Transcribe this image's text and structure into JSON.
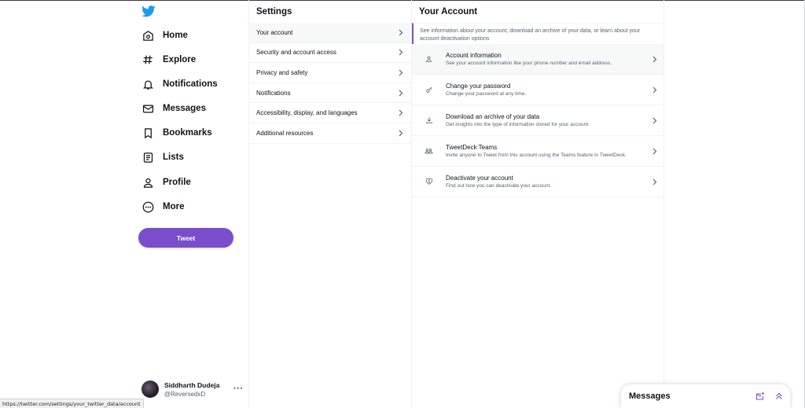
{
  "sidebar": {
    "nav": [
      {
        "label": "Home",
        "icon": "home-icon"
      },
      {
        "label": "Explore",
        "icon": "hashtag-icon"
      },
      {
        "label": "Notifications",
        "icon": "bell-icon"
      },
      {
        "label": "Messages",
        "icon": "envelope-icon"
      },
      {
        "label": "Bookmarks",
        "icon": "bookmark-icon"
      },
      {
        "label": "Lists",
        "icon": "list-icon"
      },
      {
        "label": "Profile",
        "icon": "person-icon"
      },
      {
        "label": "More",
        "icon": "more-circle-icon"
      }
    ],
    "tweet_label": "Tweet",
    "profile": {
      "name": "Siddharth Dudeja",
      "handle": "@ReversedxD",
      "more": "···"
    }
  },
  "settings": {
    "title": "Settings",
    "items": [
      {
        "label": "Your account",
        "active": true
      },
      {
        "label": "Security and account access",
        "active": false
      },
      {
        "label": "Privacy and safety",
        "active": false
      },
      {
        "label": "Notifications",
        "active": false
      },
      {
        "label": "Accessibility, display, and languages",
        "active": false
      },
      {
        "label": "Additional resources",
        "active": false
      }
    ]
  },
  "account": {
    "title": "Your Account",
    "description": "See information about your account, download an archive of your data, or learn about your account deactivation options",
    "items": [
      {
        "title": "Account information",
        "subtitle": "See your account information like your phone number and email address.",
        "icon": "person-icon"
      },
      {
        "title": "Change your password",
        "subtitle": "Change your password at any time.",
        "icon": "key-icon"
      },
      {
        "title": "Download an archive of your data",
        "subtitle": "Get insights into the type of information stored for your account.",
        "icon": "download-icon"
      },
      {
        "title": "TweetDeck Teams",
        "subtitle": "Invite anyone to Tweet from this account using the Teams feature in TweetDeck.",
        "icon": "people-icon"
      },
      {
        "title": "Deactivate your account",
        "subtitle": "Find out how you can deactivate your account.",
        "icon": "broken-heart-icon"
      }
    ]
  },
  "messages_drawer": {
    "title": "Messages"
  },
  "status_bar": {
    "url": "https://twitter.com/settings/your_twitter_data/account"
  },
  "colors": {
    "accent": "#7a4dcc",
    "brand": "#1d9bf0",
    "text": "#0f1419",
    "muted": "#536471"
  }
}
